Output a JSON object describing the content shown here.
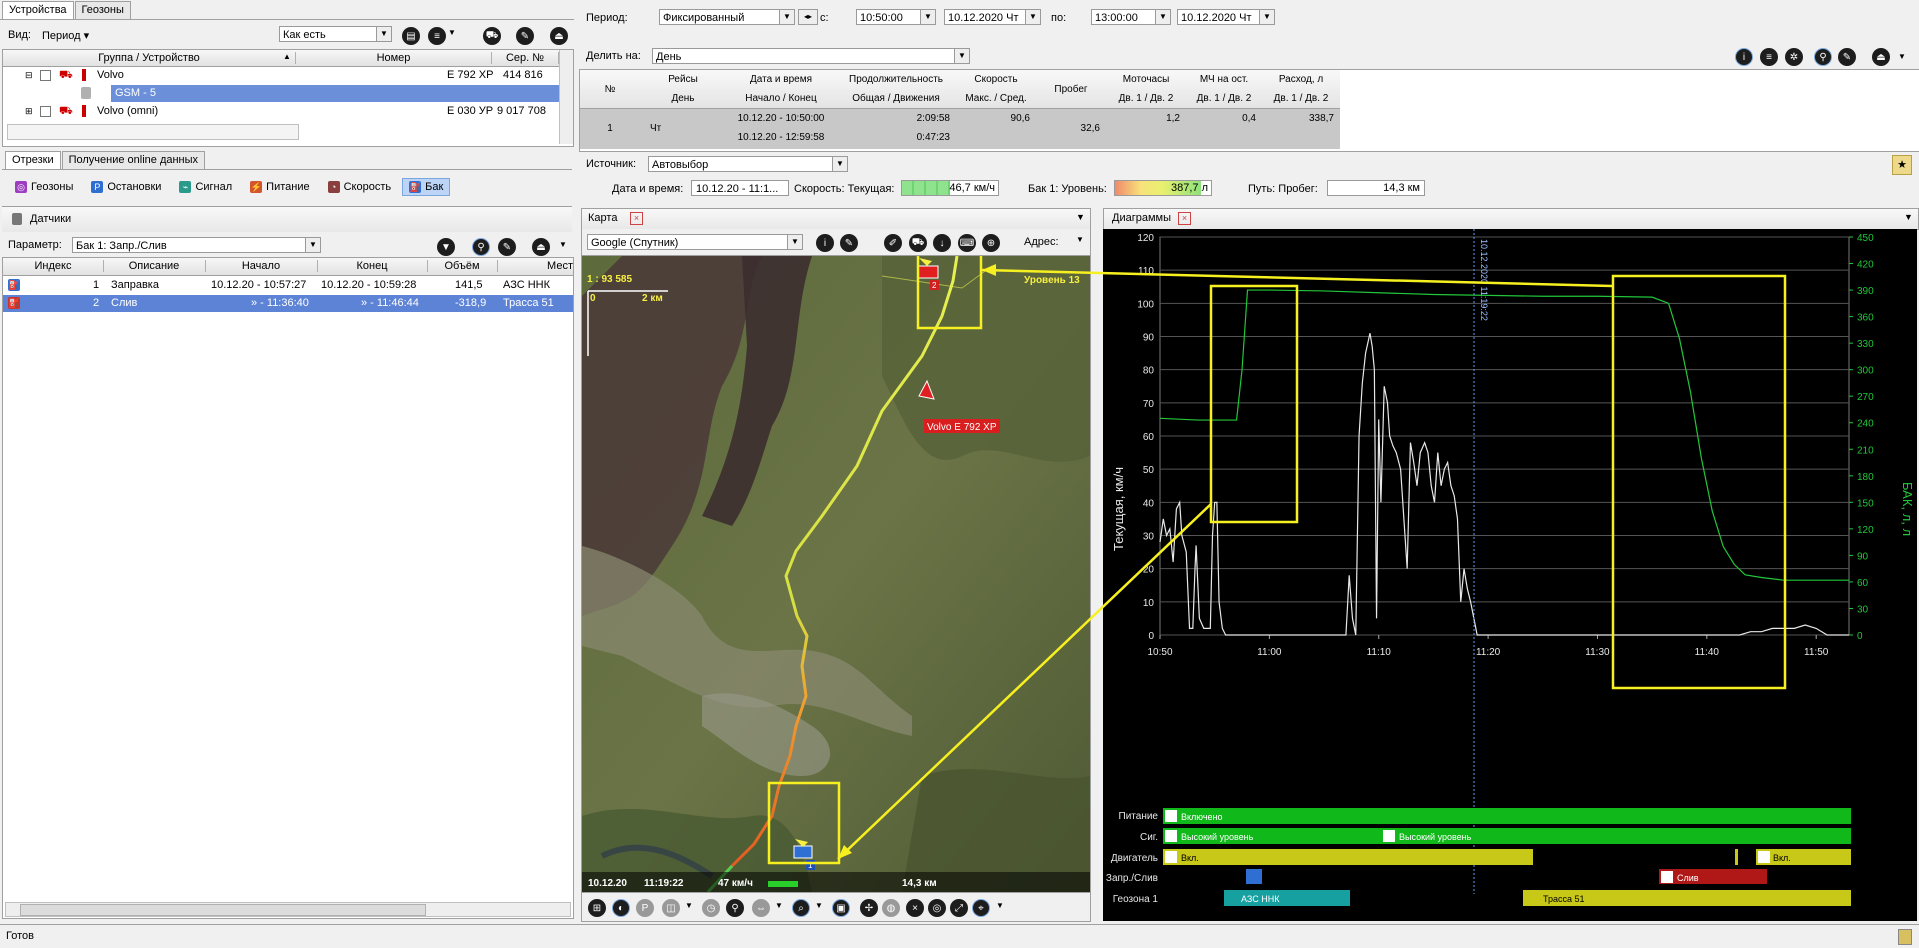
{
  "left_tabs": [
    "Устройства",
    "Геозоны"
  ],
  "view": {
    "label": "Вид:",
    "period_label": "Период",
    "mode": "Как есть"
  },
  "device_grid": {
    "headers": [
      "Группа / Устройство",
      "Номер",
      "Сер. №"
    ],
    "rows": [
      {
        "name": "Volvo",
        "number": "Е 792 ХР",
        "serial": "414 816"
      },
      {
        "name": "GSM - 5",
        "number": "",
        "serial": ""
      },
      {
        "name": "Volvo (omni)",
        "number": "Е 030 УР",
        "serial": "9 017 708"
      }
    ]
  },
  "seg_tabs": [
    "Отрезки",
    "Получение online данных"
  ],
  "param_tabs": [
    "Геозоны",
    "Остановки",
    "Сигнал",
    "Питание",
    "Скорость",
    "Бак"
  ],
  "sensors_title": "Датчики",
  "parameter": {
    "label": "Параметр:",
    "value": "Бак 1: Запр./Слив"
  },
  "events": {
    "headers": [
      "Индекс",
      "Описание",
      "Начало",
      "Конец",
      "Объём",
      "Мест"
    ],
    "rows": [
      {
        "index": "1",
        "desc": "Заправка",
        "start": "10.12.20 - 10:57:27",
        "end": "10.12.20 - 10:59:28",
        "vol": "141,5",
        "place": "АЗС ННК"
      },
      {
        "index": "2",
        "desc": "Слив",
        "start": "» - 11:36:40",
        "end": "» - 11:46:44",
        "vol": "-318,9",
        "place": "Трасса 51"
      }
    ]
  },
  "period": {
    "label": "Период:",
    "mode": "Фиксированный",
    "from_label": "с:",
    "from_time": "10:50:00",
    "from_date": "10.12.2020 Чт",
    "to_label": "по:",
    "to_time": "13:00:00",
    "to_date": "10.12.2020 Чт"
  },
  "split": {
    "label": "Делить на:",
    "value": "День"
  },
  "summary": {
    "headers_top": [
      "№",
      "Рейсы",
      "Дата и время",
      "Продолжительность",
      "Скорость",
      "Пробег",
      "Моточасы",
      "МЧ на ост.",
      "Расход, л"
    ],
    "headers_bottom": [
      "День",
      "Начало / Конец",
      "Общая / Движения",
      "Макс. / Сред.",
      "Дв. 1 / Дв. 2",
      "Дв. 1 / Дв. 2",
      "Дв. 1 / Дв. 2"
    ],
    "row": {
      "num": "1",
      "day": "Чт",
      "start": "10.12.20 - 10:50:00",
      "end": "10.12.20 - 12:59:58",
      "total": "2:09:58",
      "moving": "0:47:23",
      "speed": "90,6",
      "mileage": "32,6",
      "motohours": "1,2",
      "idle": "0,4",
      "fuel": "338,7"
    }
  },
  "source": {
    "label": "Источник:",
    "value": "Автовыбор"
  },
  "status": {
    "dt_label": "Дата и время:",
    "dt_value": "10.12.20 - 11:1...",
    "speed_label": "Скорость: Текущая:",
    "speed_value": "46,7 км/ч",
    "tank_label": "Бак 1: Уровень:",
    "tank_value": "387,7 л",
    "path_label": "Путь: Пробег:",
    "path_value": "14,3 км"
  },
  "map": {
    "tab": "Карта",
    "provider": "Google (Спутник)",
    "address_label": "Адрес:",
    "scale": "1 : 93 585",
    "scale_zero": "0",
    "scale_km": "2 км",
    "zoom": "Уровень 13",
    "vehicle": "Volvo Е 792 ХР",
    "footer_date": "10.12.20",
    "footer_time": "11:19:22",
    "footer_speed": "47 км/ч",
    "footer_dist": "14,3 км",
    "marker1": "1",
    "marker2": "2"
  },
  "diagram": {
    "tab": "Диаграммы",
    "cursor_label": "10.12.2020 11:19:22",
    "track_labels": [
      "Питание",
      "Сиг.",
      "Двигатель",
      "Запр./Слив",
      "Геозона 1"
    ]
  },
  "tracks": {
    "power": "Включено",
    "sig1": "Высокий уровень",
    "sig2": "Высокий уровень",
    "eng1": "Вкл.",
    "eng2": "Вкл.",
    "drain": "Слив",
    "gz1": "АЗС ННК",
    "gz2": "Трасса 51"
  },
  "chart_data": {
    "type": "line",
    "xlabel": "",
    "ylabel": "Текущая, км/ч",
    "y2label": "БАК, л, л",
    "x_ticks": [
      "10:50",
      "11:00",
      "11:10",
      "11:20",
      "11:30",
      "11:40",
      "11:50"
    ],
    "xlim": [
      "10:50",
      "11:53"
    ],
    "ylim": [
      0,
      120
    ],
    "y2lim": [
      0,
      450
    ],
    "y_ticks": [
      0,
      10,
      20,
      30,
      40,
      50,
      60,
      70,
      80,
      90,
      100,
      110,
      120
    ],
    "y2_ticks": [
      0,
      30,
      60,
      90,
      120,
      150,
      180,
      210,
      240,
      270,
      300,
      330,
      360,
      390,
      420,
      450
    ],
    "grid": true,
    "series": [
      {
        "axis": "left",
        "color": "#e8e8e8",
        "x": [
          0,
          0.3,
          0.6,
          0.9,
          1.2,
          1.5,
          1.8,
          2.0,
          2.4,
          2.7,
          3.0,
          3.2,
          3.3,
          3.6,
          4.0,
          4.3,
          4.6,
          4.8,
          5.0,
          5.2,
          5.4,
          5.7,
          6.0,
          6.2,
          6.6,
          7.0,
          8.0,
          10.0,
          12.0,
          15.0,
          17.0,
          17.3,
          17.6,
          17.9,
          18.2,
          18.5,
          18.8,
          19.0,
          19.2,
          19.4,
          19.6,
          19.8,
          20.0,
          20.2,
          20.5,
          20.8,
          21.0,
          21.3,
          21.6,
          22.0,
          22.3,
          22.6,
          22.9,
          23.2,
          23.5,
          23.8,
          24.2,
          24.5,
          24.8,
          25.1,
          25.4,
          25.7,
          26.0,
          26.3,
          26.6,
          26.9,
          27.2,
          27.5,
          27.8,
          28.1,
          28.4,
          28.7,
          29.0,
          29.2,
          29.5,
          29.8,
          30.1,
          30.4,
          30.6,
          31.0,
          31.3,
          31.6,
          32.0,
          33.0,
          40.0,
          48.0,
          53.0,
          54.0,
          55.0,
          56.0,
          57.0,
          58.0,
          59.0,
          60.0,
          61.0,
          62.0,
          63.0
        ],
        "values": [
          28,
          35,
          30,
          32,
          22,
          38,
          40,
          30,
          25,
          2,
          2,
          20,
          27,
          5,
          2,
          2,
          2,
          30,
          40,
          40,
          10,
          2,
          0,
          0,
          0,
          0,
          0,
          0,
          0,
          0,
          0,
          18,
          5,
          0,
          60,
          76,
          85,
          88,
          91,
          87,
          80,
          5,
          65,
          40,
          75,
          70,
          60,
          57,
          55,
          50,
          35,
          20,
          58,
          52,
          45,
          55,
          58,
          55,
          45,
          40,
          55,
          45,
          50,
          52,
          45,
          42,
          35,
          10,
          20,
          14,
          10,
          5,
          0,
          0,
          0,
          0,
          0,
          0,
          0,
          0,
          0,
          0,
          0,
          0,
          0,
          0,
          0,
          1,
          1,
          2,
          2,
          2,
          3,
          2,
          0,
          0,
          0
        ]
      },
      {
        "axis": "right",
        "color": "#22c63a",
        "x": [
          0,
          3.5,
          5.5,
          7.0,
          7.5,
          8.0,
          10.0,
          15.0,
          20.0,
          25.0,
          30.0,
          35.0,
          40.0,
          45.0,
          46.5,
          47.5,
          48.5,
          49.5,
          50.5,
          51.5,
          52.5,
          53.5,
          55.0,
          57.0,
          60.0,
          63.0
        ],
        "values": [
          245,
          243,
          243,
          243,
          300,
          390,
          390,
          389,
          387,
          385,
          384,
          383,
          383,
          382,
          375,
          335,
          275,
          200,
          140,
          100,
          80,
          68,
          65,
          62,
          62,
          62
        ]
      }
    ]
  }
}
